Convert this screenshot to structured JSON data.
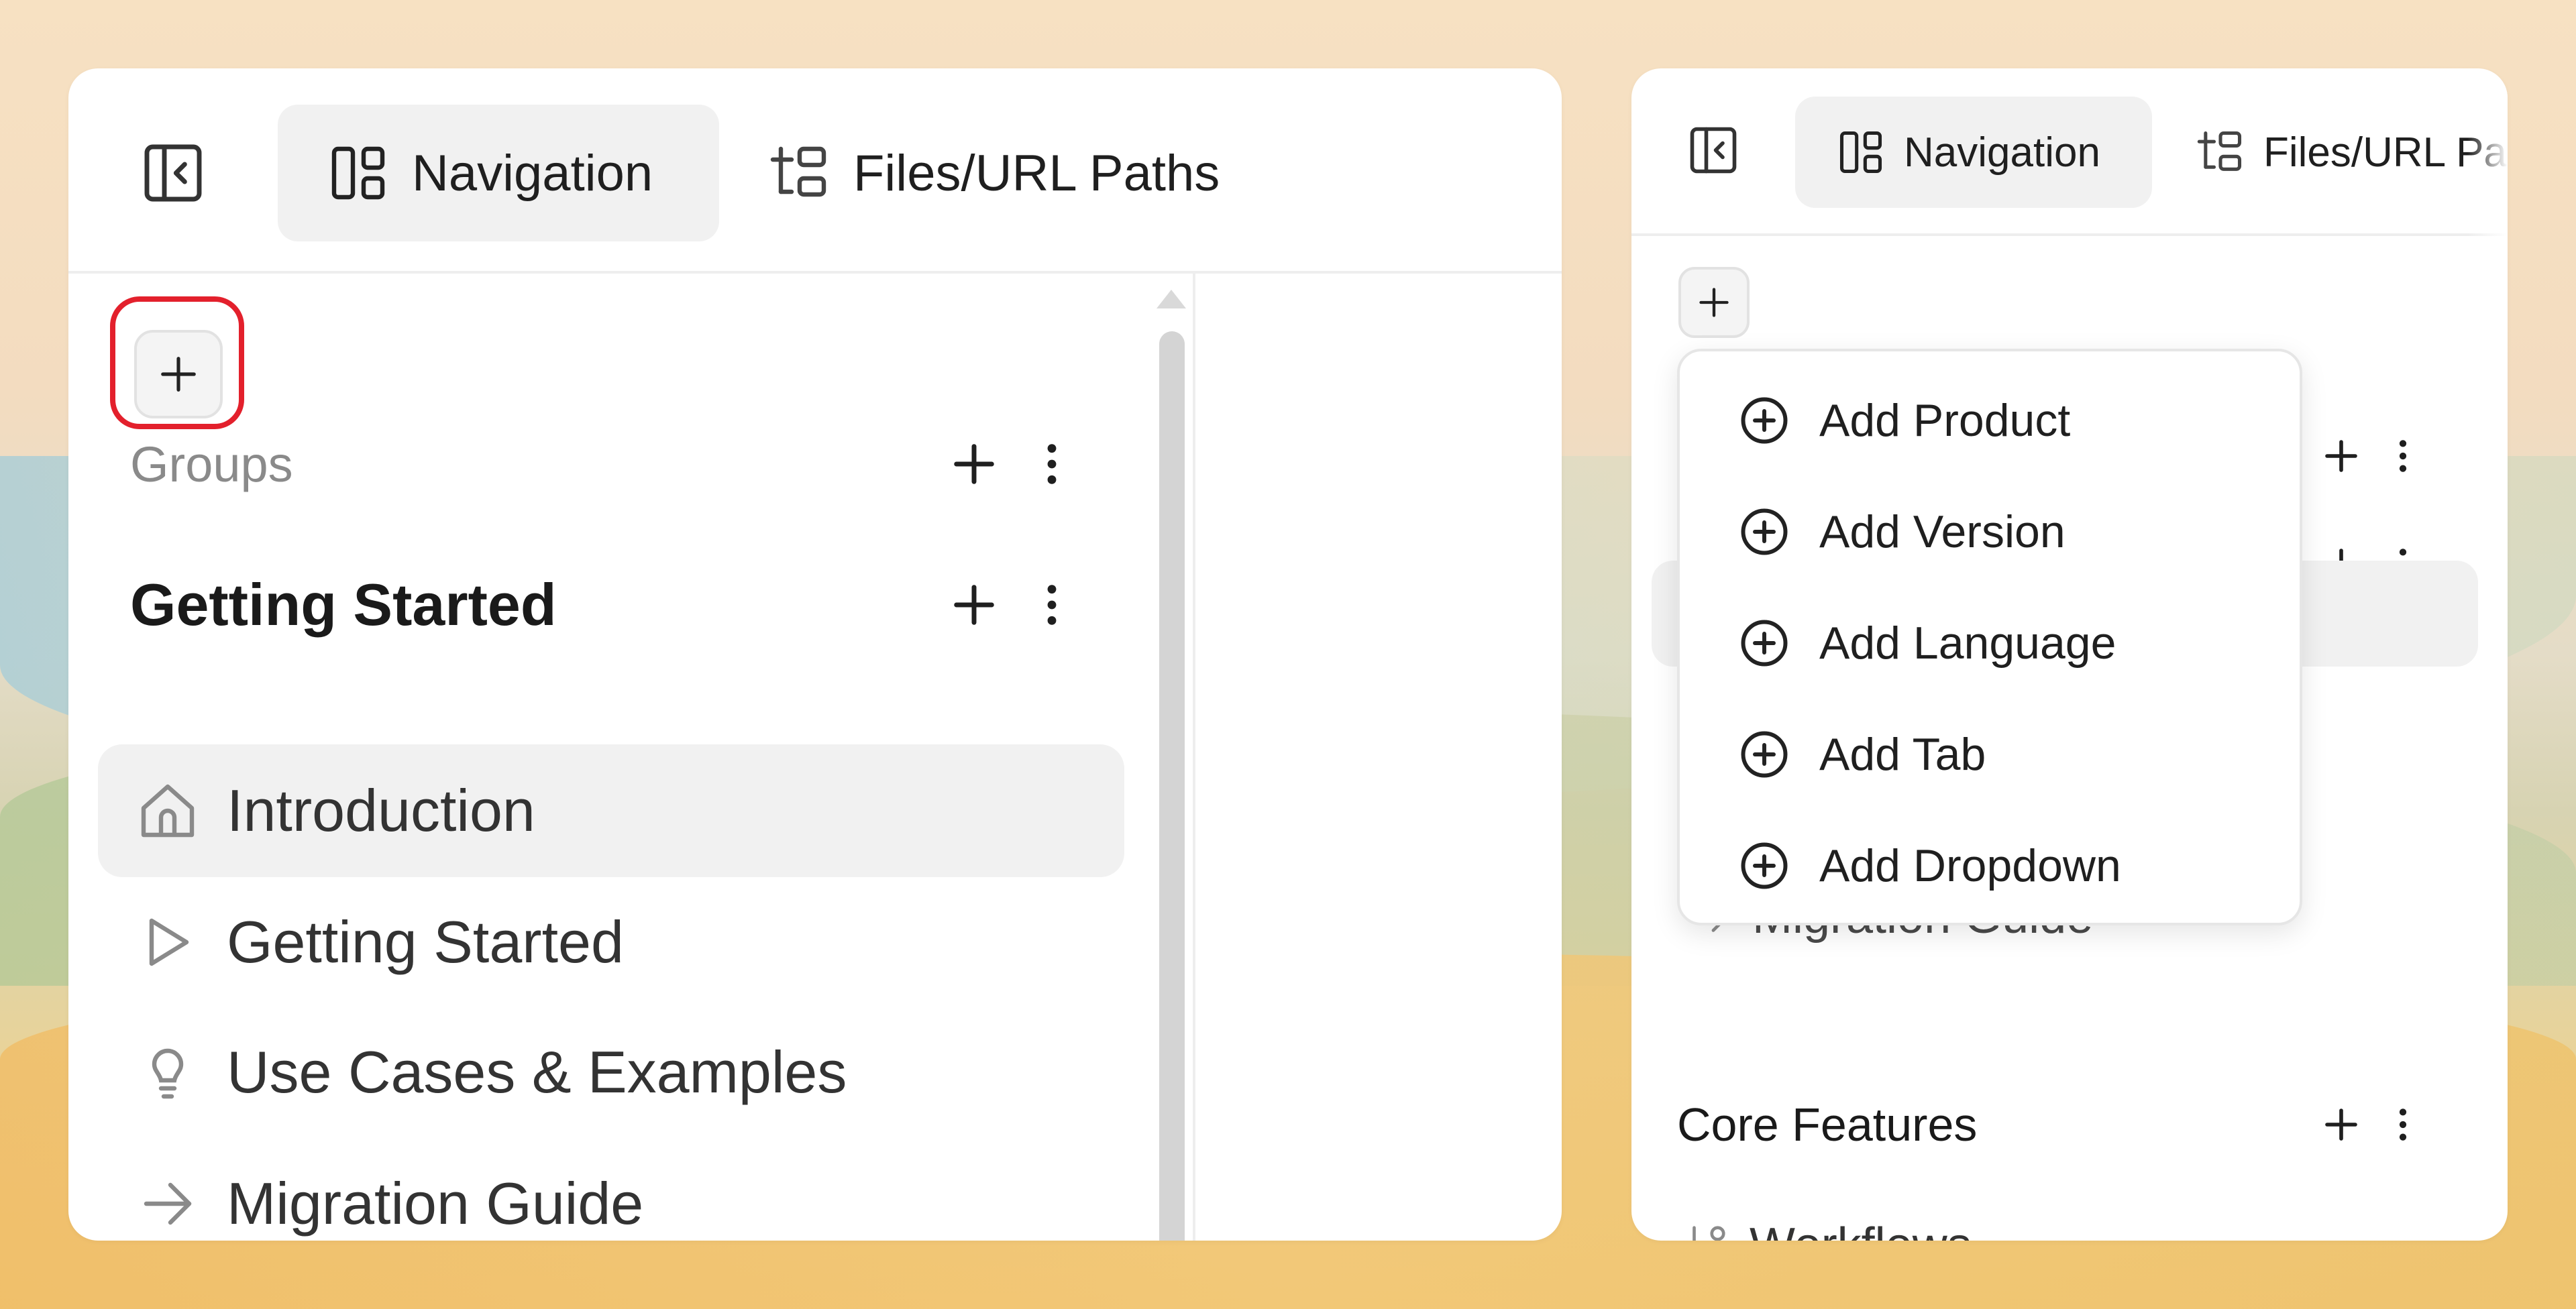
{
  "left_panel": {
    "tabs": {
      "navigation_label": "Navigation",
      "files_label": "Files/URL Paths"
    },
    "groups_label": "Groups",
    "group": {
      "title": "Getting Started",
      "items": [
        {
          "label": "Introduction",
          "icon": "home-icon",
          "active": true
        },
        {
          "label": "Getting Started",
          "icon": "play-icon"
        },
        {
          "label": "Use Cases & Examples",
          "icon": "lightbulb-icon"
        },
        {
          "label": "Migration Guide",
          "icon": "arrow-right-icon"
        }
      ]
    },
    "highlight_color": "#e3202c"
  },
  "right_panel": {
    "tabs": {
      "navigation_label": "Navigation",
      "files_label": "Files/URL Pa"
    },
    "dropdown": {
      "items": [
        "Add Product",
        "Add Version",
        "Add Language",
        "Add Tab",
        "Add Dropdown"
      ]
    },
    "migration_partial": "Migration Guide",
    "core_features_title": "Core Features",
    "workflows_label": "Workflows"
  }
}
